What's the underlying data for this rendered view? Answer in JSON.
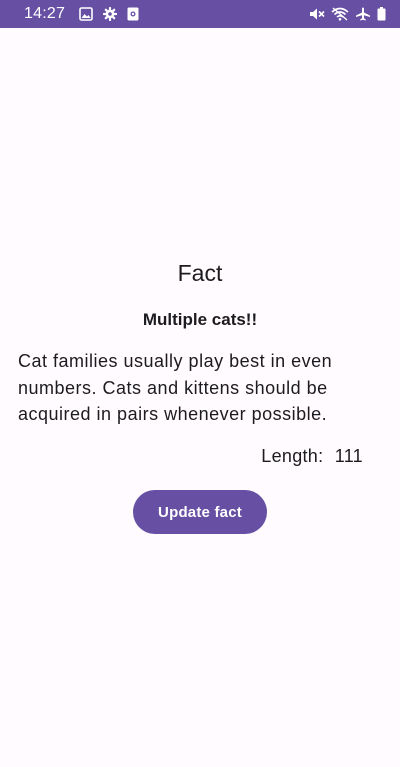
{
  "status_bar": {
    "time": "14:27",
    "background_color": "#6750a4",
    "left_icons": [
      "image-icon",
      "settings-gear-icon",
      "screen-record-icon"
    ],
    "right_icons": [
      "mute-icon",
      "wifi-off-icon",
      "airplane-icon",
      "battery-icon"
    ]
  },
  "fact": {
    "title": "Fact",
    "subtitle": "Multiple cats!!",
    "text": "Cat families usually play best in even numbers. Cats and kittens should be acquired in pairs whenever possible.",
    "length_label": "Length:",
    "length_value": "111"
  },
  "actions": {
    "update_label": "Update fact",
    "accent_color": "#6750a4"
  }
}
